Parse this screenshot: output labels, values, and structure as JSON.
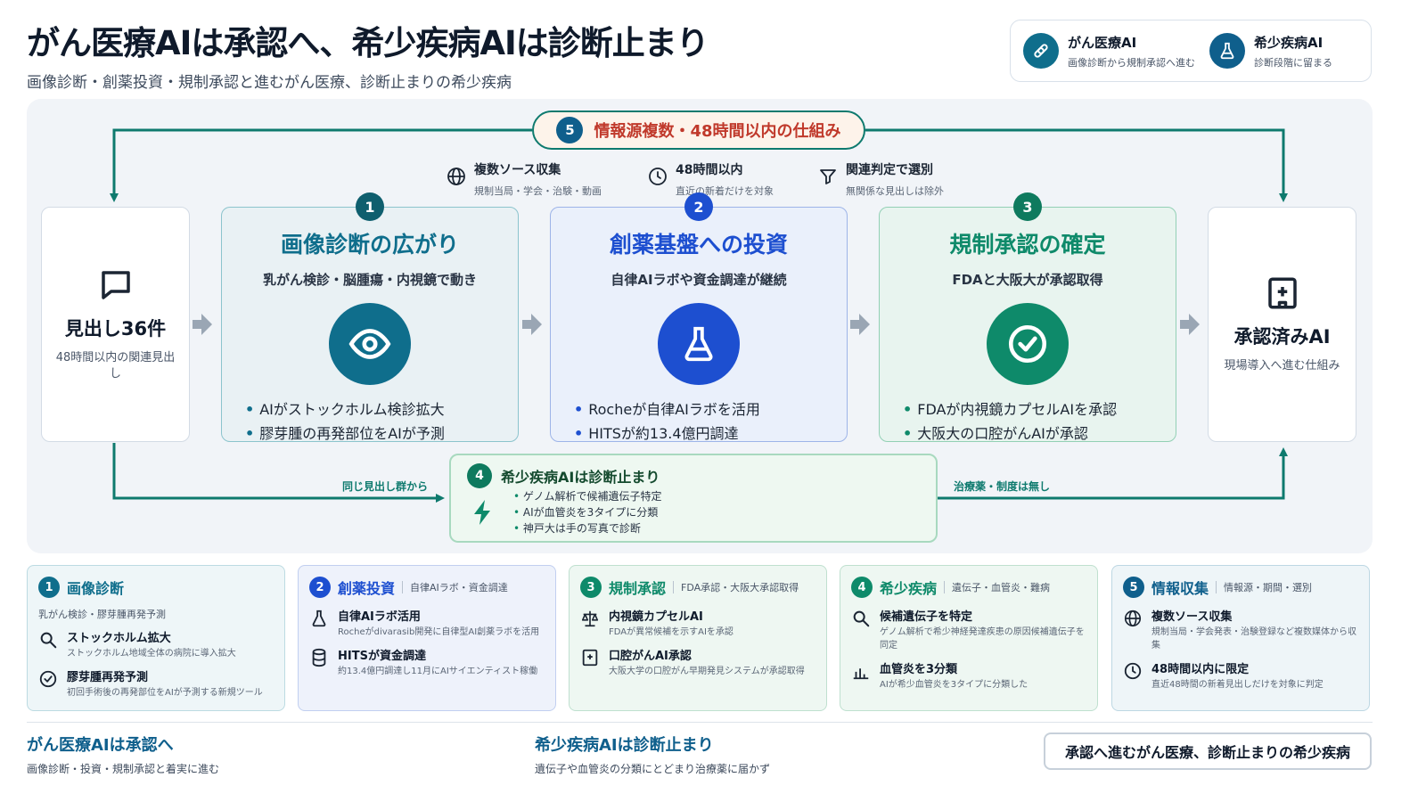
{
  "header": {
    "title": "がん医療AIは承認へ、希少疾病AIは診断止まり",
    "subtitle": "画像診断・創薬投資・規制承認と進むがん医療、診断止まりの希少疾病"
  },
  "legend": [
    {
      "title": "がん医療AI",
      "desc": "画像診断から規制承認へ進む",
      "icon": "link-icon",
      "color": "#0f6e8c"
    },
    {
      "title": "希少疾病AI",
      "desc": "診断段階に留まる",
      "icon": "flask-icon",
      "color": "#0f5f8c"
    }
  ],
  "banner": {
    "number": "5",
    "text": "情報源複数・48時間以内の仕組み"
  },
  "mechanisms": [
    {
      "icon": "globe-icon",
      "title": "複数ソース収集",
      "desc": "規制当局・学会・治験・動画"
    },
    {
      "icon": "clock-icon",
      "title": "48時間以内",
      "desc": "直近の新着だけを対象"
    },
    {
      "icon": "filter-icon",
      "title": "関連判定で選別",
      "desc": "無関係な見出しは除外"
    }
  ],
  "input_box": {
    "icon": "chat-icon",
    "title": "見出し36件",
    "desc": "48時間以内の関連見出し"
  },
  "output_box": {
    "icon": "hospital-icon",
    "title": "承認済みAI",
    "desc": "現場導入へ進む仕組み"
  },
  "stages": [
    {
      "number": "1",
      "title": "画像診断の広がり",
      "sub": "乳がん検診・脳腫瘍・内視鏡で動き",
      "icon": "eye-icon",
      "color": "#0f6e8c",
      "bullets": [
        "AIがストックホルム検診拡大",
        "膠芽腫の再発部位をAIが予測"
      ]
    },
    {
      "number": "2",
      "title": "創薬基盤への投資",
      "sub": "自律AIラボや資金調達が継続",
      "icon": "flask-icon",
      "color": "#1d4fd0",
      "bullets": [
        "Rocheが自律AIラボを活用",
        "HITSが約13.4億円調達"
      ]
    },
    {
      "number": "3",
      "title": "規制承認の確定",
      "sub": "FDAと大阪大が承認取得",
      "icon": "check-circle-icon",
      "color": "#0e8a6a",
      "bullets": [
        "FDAが内視鏡カプセルAIを承認",
        "大阪大の口腔がんAIが承認"
      ]
    }
  ],
  "rare": {
    "number": "4",
    "title": "希少疾病AIは診断止まり",
    "icon": "lightning-icon",
    "bullets": [
      "ゲノム解析で候補遺伝子特定",
      "AIが血管炎を3タイプに分類",
      "神戸大は手の写真で診断"
    ],
    "label_in": "同じ見出し群から",
    "label_out": "治療薬・制度は無し"
  },
  "cards": [
    {
      "number": "1",
      "title": "画像診断",
      "sub": "",
      "subline": "乳がん検診・膠芽腫再発予測",
      "color": "#0f6e8c",
      "items": [
        {
          "icon": "search-icon",
          "title": "ストックホルム拡大",
          "desc": "ストックホルム地域全体の病院に導入拡大"
        },
        {
          "icon": "check-circle-icon",
          "title": "膠芽腫再発予測",
          "desc": "初回手術後の再発部位をAIが予測する新規ツール"
        }
      ]
    },
    {
      "number": "2",
      "title": "創薬投資",
      "sub": "自律AIラボ・資金調達",
      "subline": "",
      "color": "#1d4fd0",
      "items": [
        {
          "icon": "flask-icon",
          "title": "自律AIラボ活用",
          "desc": "Rocheがdivarasib開発に自律型AI創薬ラボを活用"
        },
        {
          "icon": "database-icon",
          "title": "HITSが資金調達",
          "desc": "約13.4億円調達し11月にAIサイエンティスト稼働"
        }
      ]
    },
    {
      "number": "3",
      "title": "規制承認",
      "sub": "FDA承認・大阪大承認取得",
      "subline": "",
      "color": "#0e8a6a",
      "items": [
        {
          "icon": "scale-icon",
          "title": "内視鏡カプセルAI",
          "desc": "FDAが異常候補を示すAIを承認"
        },
        {
          "icon": "hospital-icon",
          "title": "口腔がんAI承認",
          "desc": "大阪大学の口腔がん早期発見システムが承認取得"
        }
      ]
    },
    {
      "number": "4",
      "title": "希少疾病",
      "sub": "遺伝子・血管炎・難病",
      "subline": "",
      "color": "#0e8a6a",
      "items": [
        {
          "icon": "search-icon",
          "title": "候補遺伝子を特定",
          "desc": "ゲノム解析で希少神経発達疾患の原因候補遺伝子を同定"
        },
        {
          "icon": "bar-chart-icon",
          "title": "血管炎を3分類",
          "desc": "AIが希少血管炎を3タイプに分類した"
        }
      ]
    },
    {
      "number": "5",
      "title": "情報収集",
      "sub": "情報源・期間・選別",
      "subline": "",
      "color": "#0f5f8c",
      "items": [
        {
          "icon": "globe-icon",
          "title": "複数ソース収集",
          "desc": "規制当局・学会発表・治験登録など複数媒体から収集"
        },
        {
          "icon": "clock-icon",
          "title": "48時間以内に限定",
          "desc": "直近48時間の新着見出しだけを対象に判定"
        }
      ]
    }
  ],
  "footer": {
    "left_title": "がん医療AIは承認へ",
    "left_desc": "画像診断・投資・規制承認と着実に進む",
    "mid_title": "希少疾病AIは診断止まり",
    "mid_desc": "遺伝子や血管炎の分類にとどまり治療薬に届かず",
    "badge": "承認へ進むがん医療、診断止まりの希少疾病"
  }
}
